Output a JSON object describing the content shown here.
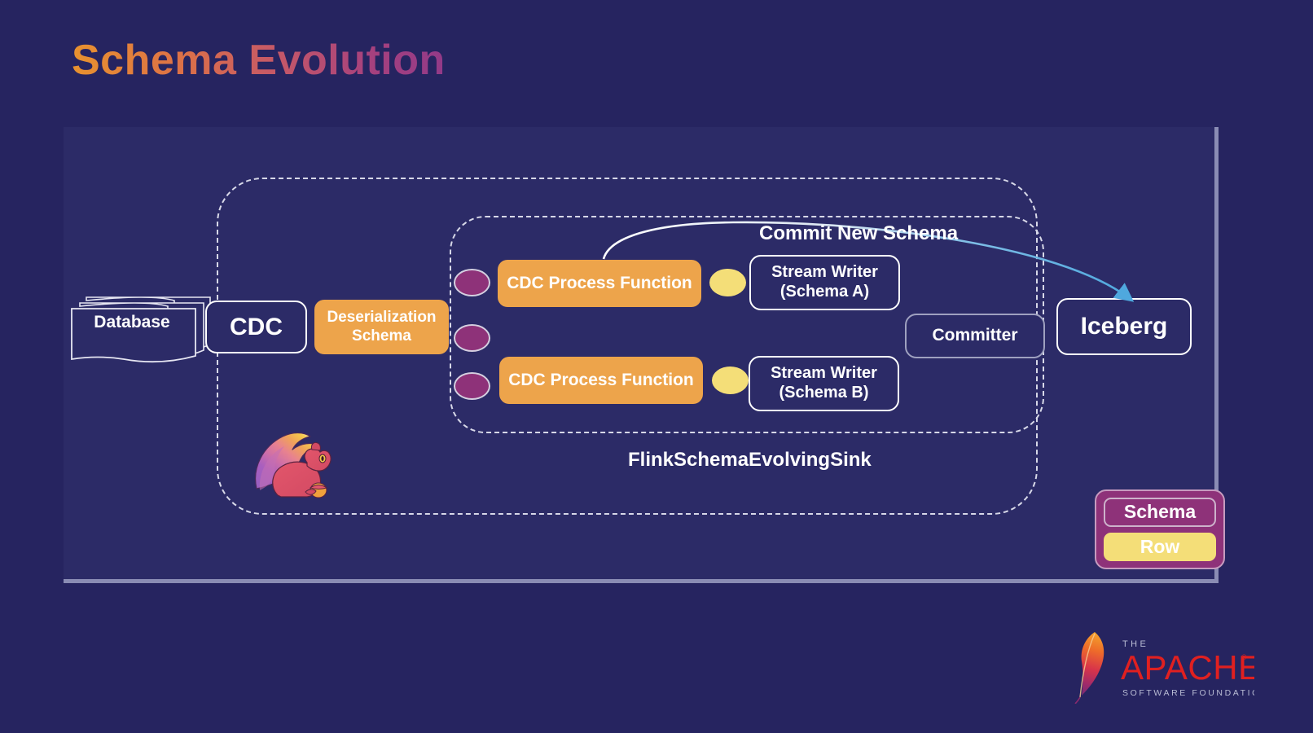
{
  "slide": {
    "title": "Schema Evolution",
    "background_color": "#262460",
    "panel_color": "#2C2B67",
    "title_gradient_from": "#E8922F",
    "title_gradient_to": "#923A88"
  },
  "containers": {
    "outer_dashed_label": "",
    "inner_dashed_label": "FlinkSchemaEvolvingSink"
  },
  "nodes": {
    "database": {
      "label": "Database",
      "style": "stacked-document",
      "color": "#2C2B67"
    },
    "cdc": {
      "label": "CDC",
      "style": "outline",
      "color": "#2C2B67"
    },
    "deserialization_schema": {
      "label": "Deserialization\nSchema",
      "line1": "Deserialization",
      "line2": "Schema",
      "style": "filled",
      "color": "#EDA44B"
    },
    "cdc_process_function_a": {
      "label": "CDC Process Function",
      "style": "filled",
      "color": "#EDA44B"
    },
    "cdc_process_function_b": {
      "label": "CDC Process Function",
      "style": "filled",
      "color": "#EDA44B"
    },
    "stream_writer_a": {
      "line1": "Stream Writer",
      "line2": "(Schema A)",
      "style": "outline",
      "color": "#2C2B67"
    },
    "stream_writer_b": {
      "line1": "Stream Writer",
      "line2": "(Schema B)",
      "style": "outline",
      "color": "#2C2B67"
    },
    "committer": {
      "label": "Committer",
      "style": "outline-dim",
      "color": "#2C2B67"
    },
    "iceberg": {
      "label": "Iceberg",
      "style": "outline",
      "color": "#2C2B67"
    }
  },
  "tokens": {
    "schema_token_color": "#8E3279",
    "row_token_color": "#F4DE78",
    "schema_token_count": 3,
    "row_token_count": 2
  },
  "edges": [
    {
      "label": "Commit New Schema",
      "from": "cdc_process_function_a",
      "to": "iceberg",
      "color_start": "#FFFFFF",
      "color_end": "#4FA8DE",
      "arrowhead": true
    }
  ],
  "legend": {
    "background_color": "#8E3279",
    "items": [
      {
        "label": "Schema",
        "style": "outline",
        "color": "#8E3279"
      },
      {
        "label": "Row",
        "style": "filled",
        "color": "#F4DE78"
      }
    ]
  },
  "logos": {
    "flink": {
      "name": "apache-flink-squirrel-logo",
      "alt": "Apache Flink squirrel"
    },
    "apache": {
      "name": "apache-software-foundation-logo",
      "line_the": "THE",
      "line_apache": "APACHE",
      "line_foundation": "SOFTWARE FOUNDATION",
      "trademark": "®",
      "color": "#E02020"
    }
  }
}
